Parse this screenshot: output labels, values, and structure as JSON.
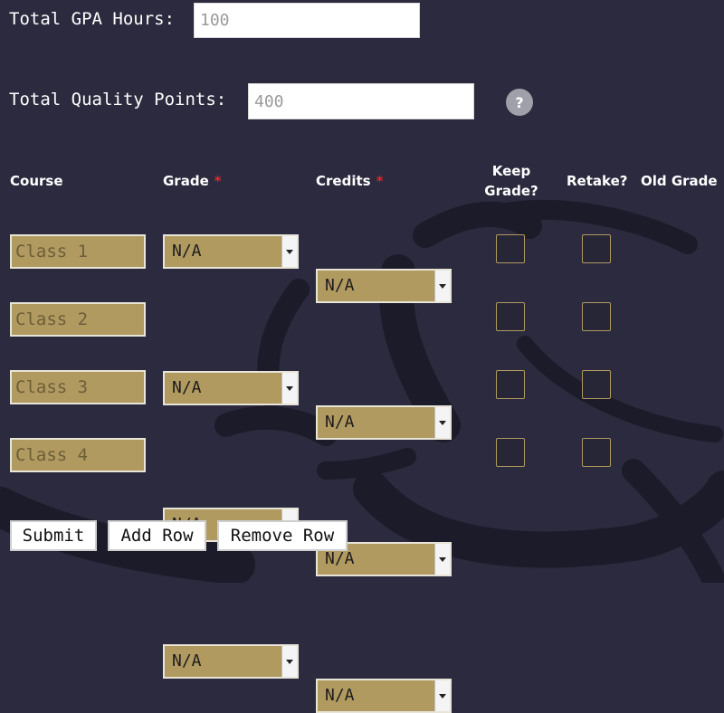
{
  "gpa_hours": {
    "label": "Total GPA Hours:",
    "placeholder": "100"
  },
  "quality_points": {
    "label": "Total Quality Points:",
    "placeholder": "400",
    "help": "?"
  },
  "table": {
    "headers": {
      "course": "Course",
      "grade": "Grade",
      "credits": "Credits",
      "keep_grade_line1": "Keep",
      "keep_grade_line2": "Grade?",
      "retake": "Retake?",
      "old_grade": "Old Grade",
      "required_mark": "*"
    },
    "rows": [
      {
        "course_placeholder": "Class 1",
        "grade": "N/A",
        "credits": "N/A"
      },
      {
        "course_placeholder": "Class 2",
        "grade": "N/A",
        "credits": "N/A"
      },
      {
        "course_placeholder": "Class 3",
        "grade": "N/A",
        "credits": "N/A"
      },
      {
        "course_placeholder": "Class 4",
        "grade": "N/A",
        "credits": "N/A"
      }
    ]
  },
  "actions": {
    "submit": "Submit",
    "add_row": "Add Row",
    "remove_row": "Remove Row"
  },
  "colors": {
    "background": "#2b2a3e",
    "gold": "#b09a60",
    "required": "#e0282e"
  }
}
